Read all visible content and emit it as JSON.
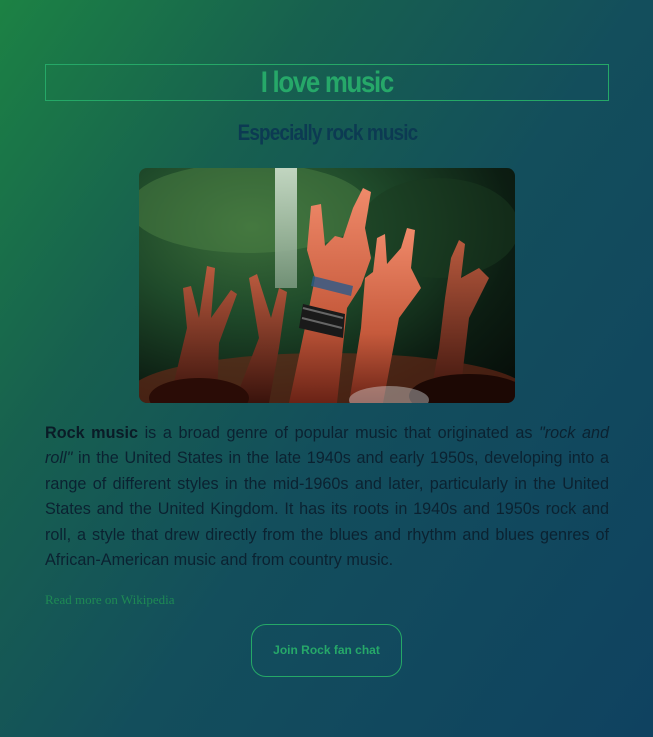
{
  "header": {
    "title": "I love music",
    "subtitle": "Especially rock music"
  },
  "image": {
    "icon": "concert-hands-photo"
  },
  "article": {
    "term": "Rock music",
    "part1": " is a broad genre of popular music that originated as ",
    "quoted": "\"rock and roll\"",
    "part2": " in the United States in the late 1940s and early 1950s, developing into a range of different styles in the mid-1960s and later, particularly in the United States and the United Kingdom. It has its roots in 1940s and 1950s rock and roll, a style that drew directly from the blues and rhythm and blues genres of African-American music and from country music."
  },
  "links": {
    "wikipedia": "Read more on Wikipedia"
  },
  "actions": {
    "join_button": "Join Rock fan chat"
  },
  "colors": {
    "accent": "#26a869",
    "text": "#0b2231",
    "gradient_start": "#1c8244",
    "gradient_end": "#0f4260"
  }
}
